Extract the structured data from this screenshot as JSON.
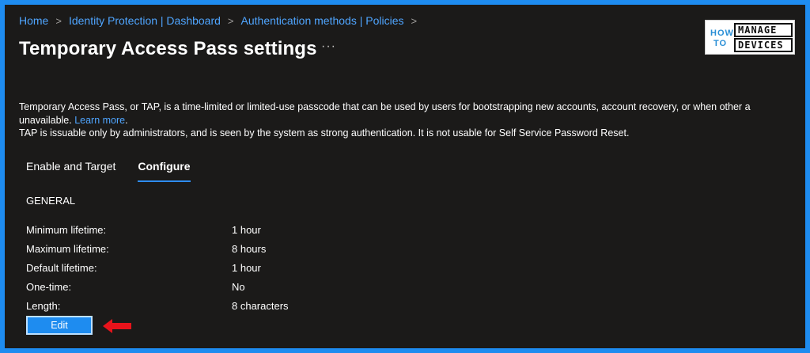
{
  "breadcrumb": {
    "items": [
      "Home",
      "Identity Protection | Dashboard",
      "Authentication methods | Policies"
    ],
    "separator": ">"
  },
  "page": {
    "title": "Temporary Access Pass settings",
    "more_label": "···"
  },
  "logo": {
    "how": "HOW",
    "to": "TO",
    "manage": "MANAGE",
    "devices": "DEVICES"
  },
  "description": {
    "line1": "Temporary Access Pass, or TAP, is a time-limited or limited-use passcode that can be used by users for bootstrapping new accounts, account recovery, or when other a",
    "line2_prefix": "unavailable.",
    "learn_more": "Learn more",
    "line2_suffix": ".",
    "line3": "TAP is issuable only by administrators, and is seen by the system as strong authentication. It is not usable for Self Service Password Reset."
  },
  "tabs": [
    {
      "label": "Enable and Target",
      "active": false
    },
    {
      "label": "Configure",
      "active": true
    }
  ],
  "section_title": "GENERAL",
  "settings": [
    {
      "label": "Minimum lifetime:",
      "value": "1 hour"
    },
    {
      "label": "Maximum lifetime:",
      "value": "8 hours"
    },
    {
      "label": "Default lifetime:",
      "value": "1 hour"
    },
    {
      "label": "One-time:",
      "value": "No"
    },
    {
      "label": "Length:",
      "value": "8 characters"
    }
  ],
  "edit_button": {
    "label": "Edit"
  },
  "colors": {
    "background": "#1b1a19",
    "border": "#1e8cf0",
    "link": "#4fa5ff",
    "accent": "#2f8cf0",
    "annotation_arrow": "#e8131b"
  }
}
